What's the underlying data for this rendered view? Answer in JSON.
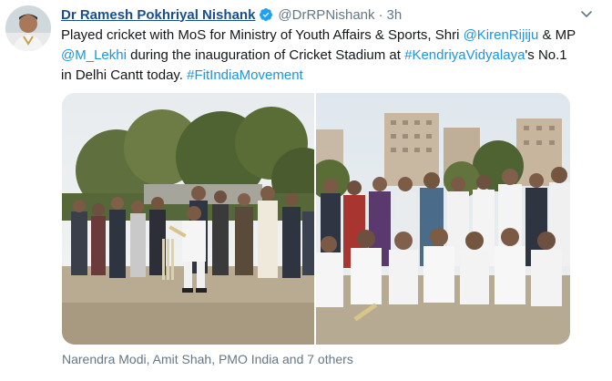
{
  "tweet": {
    "display_name": "Dr Ramesh Pokhriyal Nishank",
    "handle": "@DrRPNishank",
    "separator": "·",
    "time": "3h",
    "text": {
      "line1_pre": "Played cricket with MoS for Ministry of Youth Affairs & Sports, Shri ",
      "mention1": "@KirenRijiju",
      "line1_post": " & MP ",
      "mention2": "@M_Lekhi",
      "mid": " during the inauguration of Cricket Stadium at ",
      "hashtag1": "#KendriyaVidyalaya",
      "after_hashtag": "'s No.1 in Delhi Cantt today. ",
      "hashtag2": "#FitIndiaMovement"
    },
    "footer": "Narendra Modi, Amit Shah, PMO India and 7 others"
  },
  "icons": {
    "verified": "verified-badge-icon",
    "caret": "chevron-down-icon"
  },
  "colors": {
    "name": "#1a4f8b",
    "link": "#1b95e0",
    "muted": "#657786"
  }
}
